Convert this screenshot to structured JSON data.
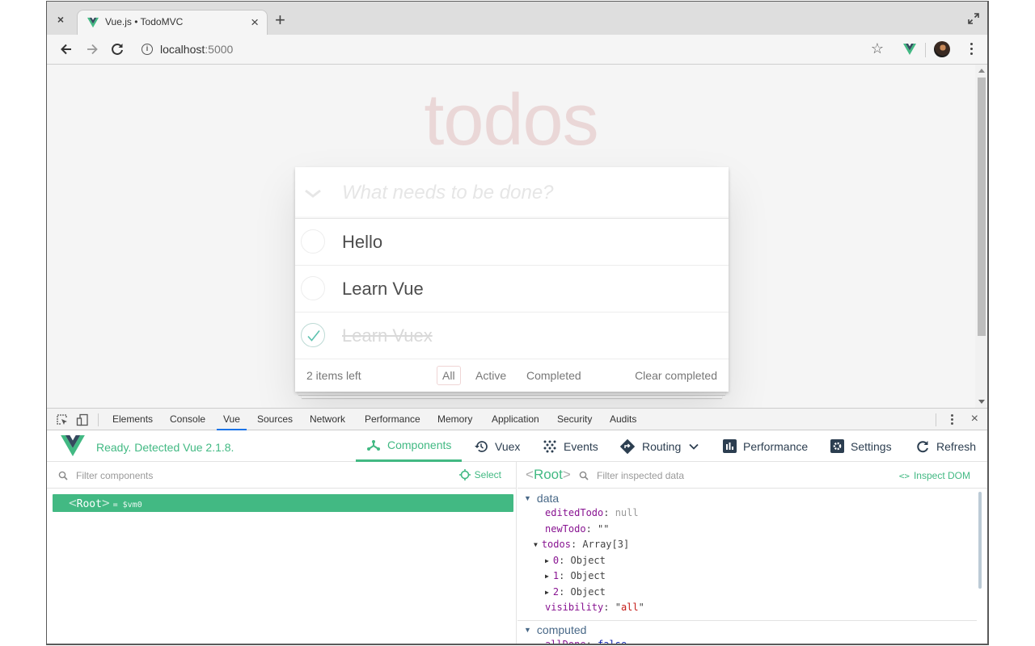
{
  "browser": {
    "inactive_tab_close": "×",
    "tab": {
      "title": "Vue.js • TodoMVC",
      "close": "×"
    },
    "new_tab": "+",
    "url_host": "localhost",
    "url_port": ":5000",
    "info_glyph": "i",
    "star_glyph": "☆"
  },
  "page": {
    "title": "todos",
    "new_todo_placeholder": "What needs to be done?",
    "new_todo_value": "",
    "todos": [
      {
        "title": "Hello",
        "completed": false
      },
      {
        "title": "Learn Vue",
        "completed": false
      },
      {
        "title": "Learn Vuex",
        "completed": true
      }
    ],
    "footer": {
      "count": "2 items left",
      "filters": [
        "All",
        "Active",
        "Completed"
      ],
      "selected_filter": "All",
      "clear_completed": "Clear completed"
    }
  },
  "devtools": {
    "tabs": [
      "Elements",
      "Console",
      "Vue",
      "Sources",
      "Network",
      "Performance",
      "Memory",
      "Application",
      "Security",
      "Audits"
    ],
    "active_tab": "Vue",
    "close": "×",
    "vue": {
      "status": "Ready. Detected Vue 2.1.8.",
      "nav": [
        {
          "label": "Components",
          "icon": "components-icon",
          "active": true
        },
        {
          "label": "Vuex",
          "icon": "history-icon",
          "active": false
        },
        {
          "label": "Events",
          "icon": "events-icon",
          "active": false
        },
        {
          "label": "Routing",
          "icon": "routing-icon",
          "active": false
        },
        {
          "label": "Performance",
          "icon": "bar-chart-icon",
          "active": false
        },
        {
          "label": "Settings",
          "icon": "settings-icon",
          "active": false
        },
        {
          "label": "Refresh",
          "icon": "refresh-icon",
          "active": false
        }
      ],
      "components": {
        "filter_placeholder": "Filter components",
        "select_label": "Select",
        "tree": [
          {
            "name": "Root",
            "ref": "= $vm0",
            "selected": true
          }
        ]
      },
      "inspector": {
        "component": "Root",
        "filter_placeholder": "Filter inspected data",
        "inspect_dom_label": "Inspect DOM",
        "inspect_dom_glyph": "<>",
        "sections": {
          "data": {
            "label": "data",
            "props": {
              "editedTodo": {
                "key": "editedTodo",
                "value": "null"
              },
              "newTodo": {
                "key": "newTodo",
                "value": "\"\""
              },
              "todos": {
                "key": "todos",
                "value": "Array[3]"
              },
              "todos_items": [
                {
                  "key": "0",
                  "value": "Object"
                },
                {
                  "key": "1",
                  "value": "Object"
                },
                {
                  "key": "2",
                  "value": "Object"
                }
              ],
              "visibility": {
                "key": "visibility",
                "value": "all"
              }
            }
          },
          "computed": {
            "label": "computed",
            "props": {
              "allDone": {
                "key": "allDone",
                "value": "false"
              }
            }
          }
        }
      }
    }
  },
  "colors": {
    "vue_green": "#42b983",
    "vue_dark": "#35495e",
    "todos_title": "rgba(175,47,47,0.15)",
    "devtools_active_tab": "#1a73e8"
  }
}
